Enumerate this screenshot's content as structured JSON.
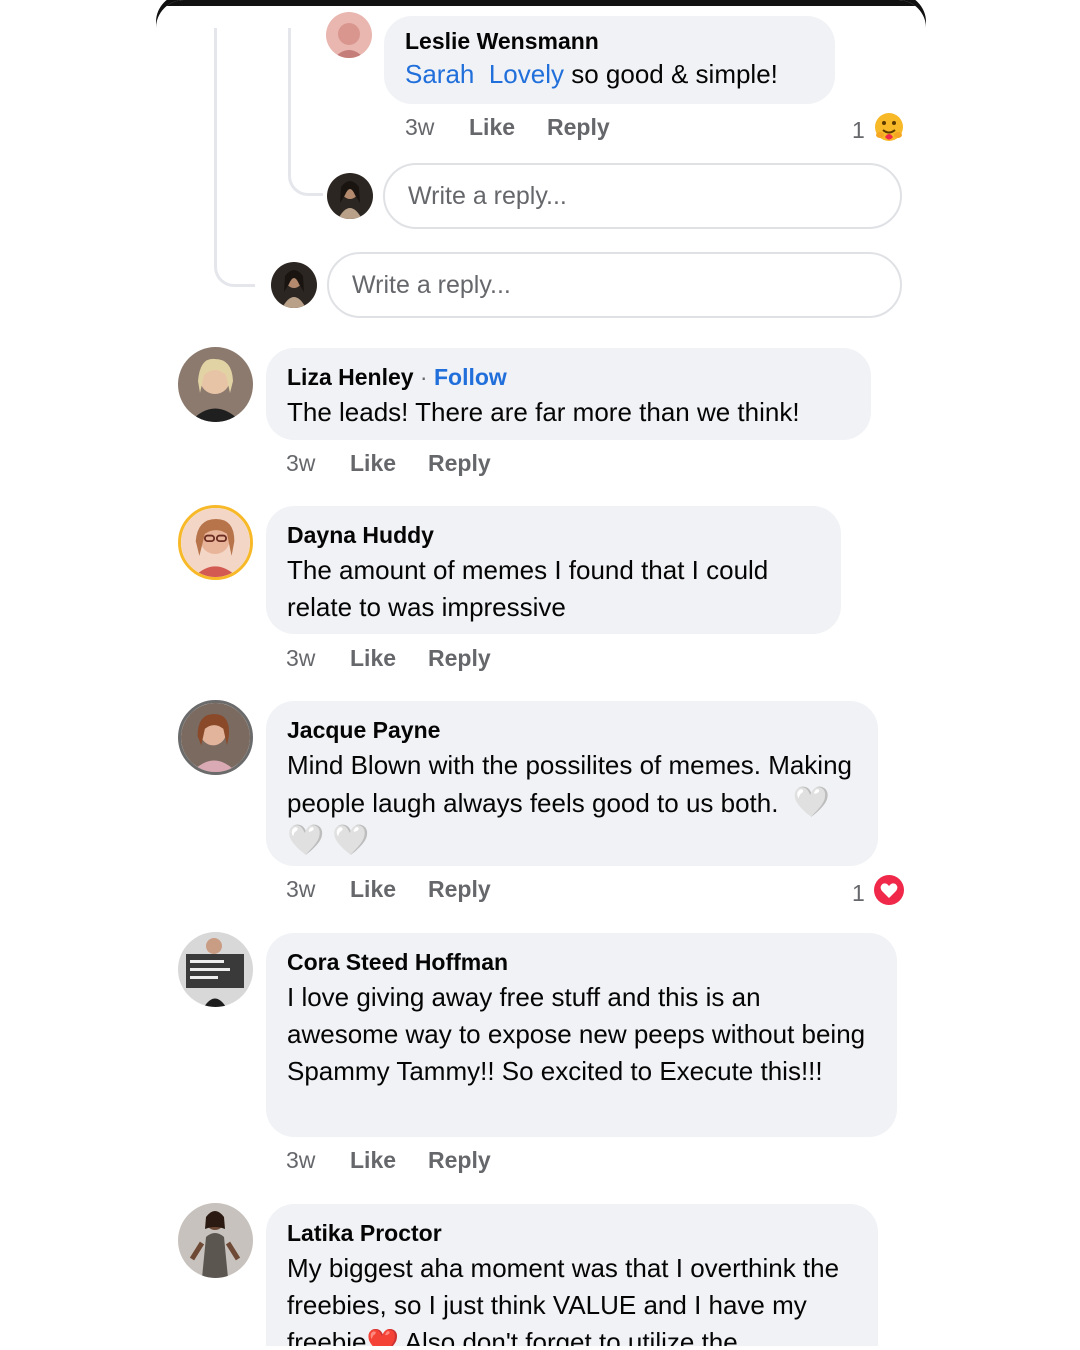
{
  "comments": {
    "leslie": {
      "author": "Leslie Wensmann",
      "mention_1": "Sarah",
      "mention_2": "Lovely",
      "text": " so good & simple!",
      "time": "3w",
      "like": "Like",
      "reply": "Reply",
      "reaction_count": "1",
      "reaction_icon": "care-emoji-icon"
    },
    "liza": {
      "author": "Liza Henley",
      "separator": " · ",
      "follow": "Follow",
      "text": "The leads! There are far more than we think!",
      "time": "3w",
      "like": "Like",
      "reply": "Reply"
    },
    "dayna": {
      "author": "Dayna Huddy",
      "text": "The amount of memes I found that I could relate to was impressive",
      "time": "3w",
      "like": "Like",
      "reply": "Reply"
    },
    "jacque": {
      "author": "Jacque Payne",
      "text": "Mind Blown with the possilites of memes. Making people laugh always feels good to us both.",
      "hearts": "🤍🤍🤍",
      "time": "3w",
      "like": "Like",
      "reply": "Reply",
      "reaction_count": "1",
      "reaction_icon": "love-reaction-icon"
    },
    "cora": {
      "author": "Cora Steed Hoffman",
      "text": "I love giving away free stuff and this is an awesome way to expose new peeps without being Spammy Tammy!! So excited to Execute this!!!",
      "time": "3w",
      "like": "Like",
      "reply": "Reply"
    },
    "latika": {
      "author": "Latika Proctor",
      "text_1": "My biggest aha moment was that I overthink the freebies, so I just think VALUE and I have my freebie",
      "heart": "❤️",
      "text_2": " Also don't forget to utilize the"
    }
  },
  "reply_inputs": {
    "nested_placeholder": "Write a reply...",
    "thread_placeholder": "Write a reply..."
  },
  "colors": {
    "bubble": "#f0f2f5",
    "link_blue": "#216fdb",
    "meta_gray": "#65676b",
    "love_red": "#f02849",
    "story_ring": "#f7b928"
  }
}
